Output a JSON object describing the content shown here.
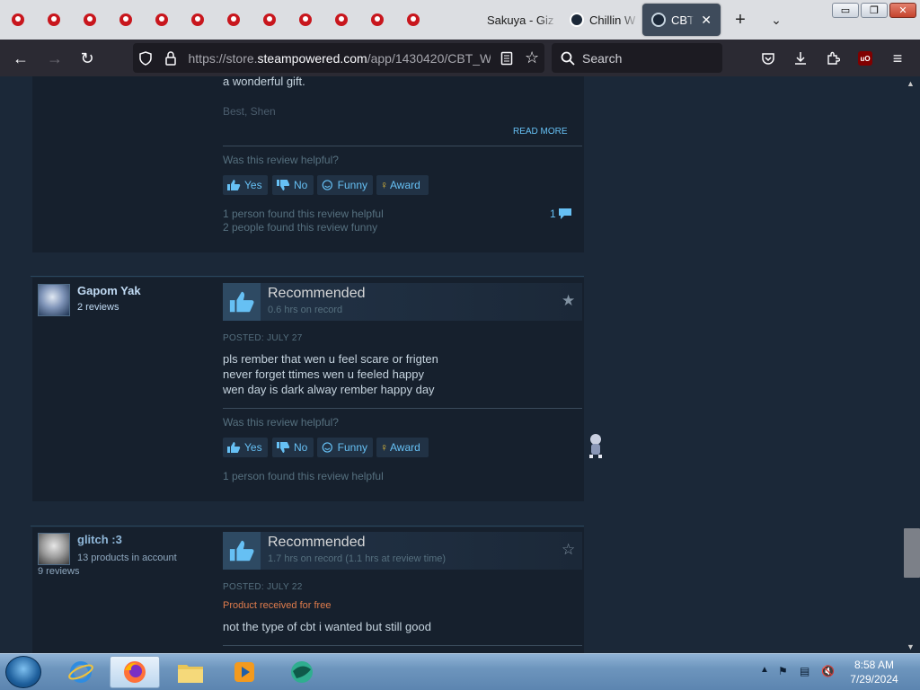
{
  "browser": {
    "tabs": [
      {
        "label": "Sakuya - Giz",
        "active": false
      },
      {
        "label": "Chillin W",
        "active": false
      },
      {
        "label": "CBT V",
        "active": true
      }
    ],
    "pinned_tab_count": 12,
    "new_tab_icon": "plus-icon",
    "url_prefix": "https://store.",
    "url_domain": "steampowered.com",
    "url_path": "/app/1430420/CBT_W",
    "search_placeholder": "Search",
    "ublock_label": "uO"
  },
  "review1": {
    "tail_line": "a wonderful gift.",
    "signoff": "Best, Shen",
    "read_more": "READ MORE",
    "helpful_question": "Was this review helpful?",
    "buttons": {
      "yes": "Yes",
      "no": "No",
      "funny": "Funny",
      "award": "Award"
    },
    "found_helpful": "1 person found this review helpful",
    "found_funny": "2 people found this review funny",
    "comment_count": "1"
  },
  "review2": {
    "author": "Gapom Yak",
    "reviews_count": "2 reviews",
    "verdict": "Recommended",
    "hours": "0.6 hrs on record",
    "posted": "POSTED: JULY 27",
    "body": [
      "pls rember that wen u feel scare or frigten",
      "never forget ttimes wen u feeled happy",
      "wen day is dark alway rember happy day"
    ],
    "helpful_question": "Was this review helpful?",
    "buttons": {
      "yes": "Yes",
      "no": "No",
      "funny": "Funny",
      "award": "Award"
    },
    "found_helpful": "1 person found this review helpful"
  },
  "review3": {
    "author": "glitch :3",
    "products": "13 products in account",
    "reviews_count": "9 reviews",
    "verdict": "Recommended",
    "hours": "1.7 hrs on record (1.1 hrs at review time)",
    "posted": "POSTED: JULY 22",
    "free_notice": "Product received for free",
    "body": "not the type of cbt i wanted but still good"
  },
  "taskbar": {
    "time": "8:58 AM",
    "date": "7/29/2024"
  },
  "colors": {
    "page_bg": "#1b2838",
    "review_bg": "#16202d",
    "link_blue": "#66c0f4",
    "free_orange": "#e07c4c"
  }
}
